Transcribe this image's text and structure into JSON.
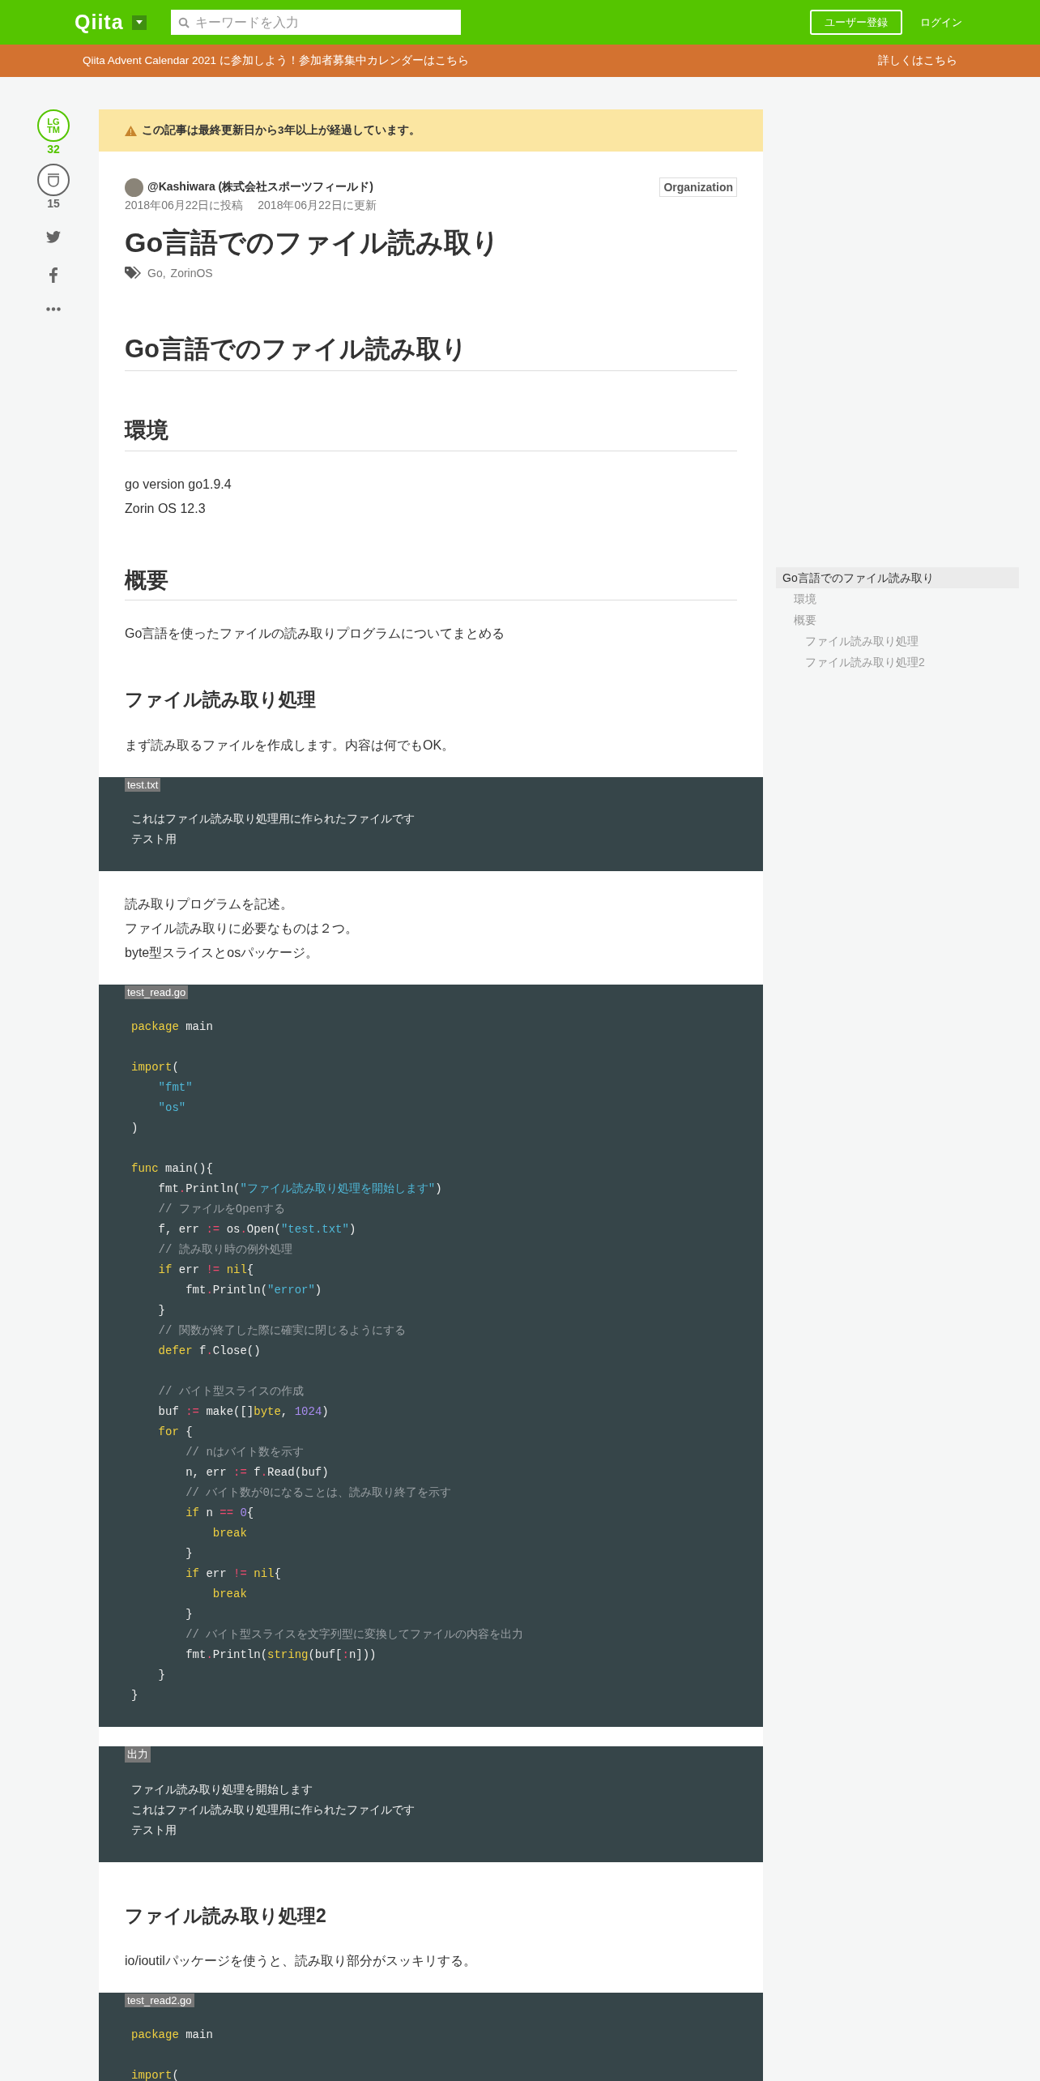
{
  "header": {
    "logo": "Qiita",
    "search": {
      "placeholder": "キーワードを入力"
    },
    "signup": "ユーザー登録",
    "login": "ログイン"
  },
  "banner": {
    "text": "Qiita Advent Calendar 2021 に参加しよう！参加者募集中カレンダーはこちら",
    "link": "詳しくはこちら"
  },
  "actions": {
    "lgtm": {
      "label": [
        "LG",
        "TM"
      ],
      "count": "32"
    },
    "stock": {
      "count": "15"
    }
  },
  "notice": "この記事は最終更新日から3年以上が経過しています。",
  "article": {
    "author": "@Kashiwara (株式会社スポーツフィールド)",
    "organization": "Organization",
    "posted": "2018年06月22日に投稿",
    "updated": "2018年06月22日に更新",
    "title": "Go言語でのファイル読み取り",
    "tag_separator": ",",
    "tags": [
      "Go",
      "ZorinOS"
    ]
  },
  "body": [
    {
      "kind": "h1",
      "text": "Go言語でのファイル読み取り"
    },
    {
      "kind": "h2",
      "text": "環境"
    },
    {
      "kind": "p",
      "lines": [
        "go version go1.9.4",
        "Zorin OS 12.3"
      ]
    },
    {
      "kind": "h2",
      "text": "概要"
    },
    {
      "kind": "p",
      "lines": [
        "Go言語を使ったファイルの読み取りプログラムについてまとめる"
      ]
    },
    {
      "kind": "h3",
      "text": "ファイル読み取り処理"
    },
    {
      "kind": "p",
      "lines": [
        "まず読み取るファイルを作成します。内容は何でもOK。"
      ]
    },
    {
      "kind": "code",
      "label": "test.txt",
      "lines": [
        {
          "kind": "code",
          "tokens": [
            {
              "kind": "plain",
              "text": "これはファイル読み取り処理用に作られたファイルです"
            }
          ]
        },
        {
          "kind": "code",
          "tokens": [
            {
              "kind": "plain",
              "text": "テスト用"
            }
          ]
        }
      ]
    },
    {
      "kind": "p",
      "lines": [
        "読み取りプログラムを記述。",
        "ファイル読み取りに必要なものは２つ。",
        "byte型スライスとosパッケージ。"
      ]
    },
    {
      "kind": "code",
      "label": "test_read.go",
      "lines": [
        {
          "kind": "code",
          "tokens": [
            {
              "kind": "kw",
              "text": "package"
            },
            {
              "kind": "plain",
              "text": " main"
            }
          ]
        },
        {
          "kind": "blank"
        },
        {
          "kind": "code",
          "tokens": [
            {
              "kind": "kw",
              "text": "import"
            },
            {
              "kind": "plain",
              "text": "("
            }
          ]
        },
        {
          "kind": "code",
          "tokens": [
            {
              "kind": "str",
              "text": "    \"fmt\""
            }
          ]
        },
        {
          "kind": "code",
          "tokens": [
            {
              "kind": "str",
              "text": "    \"os\""
            }
          ]
        },
        {
          "kind": "code",
          "tokens": [
            {
              "kind": "plain",
              "text": ")"
            }
          ]
        },
        {
          "kind": "blank"
        },
        {
          "kind": "code",
          "tokens": [
            {
              "kind": "kw",
              "text": "func"
            },
            {
              "kind": "plain",
              "text": " main(){"
            }
          ]
        },
        {
          "kind": "code",
          "tokens": [
            {
              "kind": "plain",
              "text": "    fmt"
            },
            {
              "kind": "op",
              "text": "."
            },
            {
              "kind": "plain",
              "text": "Println("
            },
            {
              "kind": "str",
              "text": "\"ファイル読み取り処理を開始します\""
            },
            {
              "kind": "plain",
              "text": ")"
            }
          ]
        },
        {
          "kind": "code",
          "tokens": [
            {
              "kind": "comment",
              "text": "    // ファイルをOpenする"
            }
          ]
        },
        {
          "kind": "code",
          "tokens": [
            {
              "kind": "plain",
              "text": "    f, err "
            },
            {
              "kind": "op",
              "text": ":="
            },
            {
              "kind": "plain",
              "text": " os"
            },
            {
              "kind": "op",
              "text": "."
            },
            {
              "kind": "plain",
              "text": "Open("
            },
            {
              "kind": "str",
              "text": "\"test.txt\""
            },
            {
              "kind": "plain",
              "text": ")"
            }
          ]
        },
        {
          "kind": "code",
          "tokens": [
            {
              "kind": "comment",
              "text": "    // 読み取り時の例外処理"
            }
          ]
        },
        {
          "kind": "code",
          "tokens": [
            {
              "kind": "kw",
              "text": "    if"
            },
            {
              "kind": "plain",
              "text": " err "
            },
            {
              "kind": "op",
              "text": "!="
            },
            {
              "kind": "kw",
              "text": " nil"
            },
            {
              "kind": "plain",
              "text": "{"
            }
          ]
        },
        {
          "kind": "code",
          "tokens": [
            {
              "kind": "plain",
              "text": "        fmt"
            },
            {
              "kind": "op",
              "text": "."
            },
            {
              "kind": "plain",
              "text": "Println("
            },
            {
              "kind": "str",
              "text": "\"error\""
            },
            {
              "kind": "plain",
              "text": ")"
            }
          ]
        },
        {
          "kind": "code",
          "tokens": [
            {
              "kind": "plain",
              "text": "    }"
            }
          ]
        },
        {
          "kind": "code",
          "tokens": [
            {
              "kind": "comment",
              "text": "    // 関数が終了した際に確実に閉じるようにする"
            }
          ]
        },
        {
          "kind": "code",
          "tokens": [
            {
              "kind": "kw",
              "text": "    defer"
            },
            {
              "kind": "plain",
              "text": " f"
            },
            {
              "kind": "op",
              "text": "."
            },
            {
              "kind": "plain",
              "text": "Close()"
            }
          ]
        },
        {
          "kind": "blank"
        },
        {
          "kind": "code",
          "tokens": [
            {
              "kind": "comment",
              "text": "    // バイト型スライスの作成"
            }
          ]
        },
        {
          "kind": "code",
          "tokens": [
            {
              "kind": "plain",
              "text": "    buf "
            },
            {
              "kind": "op",
              "text": ":="
            },
            {
              "kind": "plain",
              "text": " make([]"
            },
            {
              "kind": "kw",
              "text": "byte"
            },
            {
              "kind": "plain",
              "text": ", "
            },
            {
              "kind": "num",
              "text": "1024"
            },
            {
              "kind": "plain",
              "text": ")"
            }
          ]
        },
        {
          "kind": "code",
          "tokens": [
            {
              "kind": "kw",
              "text": "    for"
            },
            {
              "kind": "plain",
              "text": " {"
            }
          ]
        },
        {
          "kind": "code",
          "tokens": [
            {
              "kind": "comment",
              "text": "        // nはバイト数を示す"
            }
          ]
        },
        {
          "kind": "code",
          "tokens": [
            {
              "kind": "plain",
              "text": "        n, err "
            },
            {
              "kind": "op",
              "text": ":="
            },
            {
              "kind": "plain",
              "text": " f"
            },
            {
              "kind": "op",
              "text": "."
            },
            {
              "kind": "plain",
              "text": "Read(buf)"
            }
          ]
        },
        {
          "kind": "code",
          "tokens": [
            {
              "kind": "comment",
              "text": "        // バイト数が0になることは、読み取り終了を示す"
            }
          ]
        },
        {
          "kind": "code",
          "tokens": [
            {
              "kind": "kw",
              "text": "        if"
            },
            {
              "kind": "plain",
              "text": " n "
            },
            {
              "kind": "op",
              "text": "=="
            },
            {
              "kind": "num",
              "text": " 0"
            },
            {
              "kind": "plain",
              "text": "{"
            }
          ]
        },
        {
          "kind": "code",
          "tokens": [
            {
              "kind": "kw",
              "text": "            break"
            }
          ]
        },
        {
          "kind": "code",
          "tokens": [
            {
              "kind": "plain",
              "text": "        }"
            }
          ]
        },
        {
          "kind": "code",
          "tokens": [
            {
              "kind": "kw",
              "text": "        if"
            },
            {
              "kind": "plain",
              "text": " err "
            },
            {
              "kind": "op",
              "text": "!="
            },
            {
              "kind": "kw",
              "text": " nil"
            },
            {
              "kind": "plain",
              "text": "{"
            }
          ]
        },
        {
          "kind": "code",
          "tokens": [
            {
              "kind": "kw",
              "text": "            break"
            }
          ]
        },
        {
          "kind": "code",
          "tokens": [
            {
              "kind": "plain",
              "text": "        }"
            }
          ]
        },
        {
          "kind": "code",
          "tokens": [
            {
              "kind": "comment",
              "text": "        // バイト型スライスを文字列型に変換してファイルの内容を出力"
            }
          ]
        },
        {
          "kind": "code",
          "tokens": [
            {
              "kind": "plain",
              "text": "        fmt"
            },
            {
              "kind": "op",
              "text": "."
            },
            {
              "kind": "plain",
              "text": "Println("
            },
            {
              "kind": "kw",
              "text": "string"
            },
            {
              "kind": "plain",
              "text": "(buf["
            },
            {
              "kind": "op",
              "text": ":"
            },
            {
              "kind": "plain",
              "text": "n]))"
            }
          ]
        },
        {
          "kind": "code",
          "tokens": [
            {
              "kind": "plain",
              "text": "    }"
            }
          ]
        },
        {
          "kind": "code",
          "tokens": [
            {
              "kind": "plain",
              "text": "}"
            }
          ]
        }
      ]
    },
    {
      "kind": "code",
      "label": "出力",
      "lines": [
        {
          "kind": "code",
          "tokens": [
            {
              "kind": "plain",
              "text": "ファイル読み取り処理を開始します"
            }
          ]
        },
        {
          "kind": "code",
          "tokens": [
            {
              "kind": "plain",
              "text": "これはファイル読み取り処理用に作られたファイルです"
            }
          ]
        },
        {
          "kind": "code",
          "tokens": [
            {
              "kind": "plain",
              "text": "テスト用"
            }
          ]
        }
      ]
    },
    {
      "kind": "h3",
      "text": "ファイル読み取り処理2"
    },
    {
      "kind": "p",
      "lines": [
        "io/ioutilパッケージを使うと、読み取り部分がスッキリする。"
      ]
    },
    {
      "kind": "code",
      "label": "test_read2.go",
      "lines": [
        {
          "kind": "code",
          "tokens": [
            {
              "kind": "kw",
              "text": "package"
            },
            {
              "kind": "plain",
              "text": " main"
            }
          ]
        },
        {
          "kind": "blank"
        },
        {
          "kind": "code",
          "tokens": [
            {
              "kind": "kw",
              "text": "import"
            },
            {
              "kind": "plain",
              "text": "("
            }
          ]
        }
      ]
    }
  ],
  "toc": [
    {
      "text": "Go言語でのファイル読み取り",
      "selected": true,
      "children": [
        {
          "text": "環境",
          "selected": false
        },
        {
          "text": "概要",
          "selected": false,
          "children": [
            {
              "text": "ファイル読み取り処理",
              "selected": false
            },
            {
              "text": "ファイル読み取り処理2",
              "selected": false
            }
          ]
        }
      ]
    }
  ]
}
